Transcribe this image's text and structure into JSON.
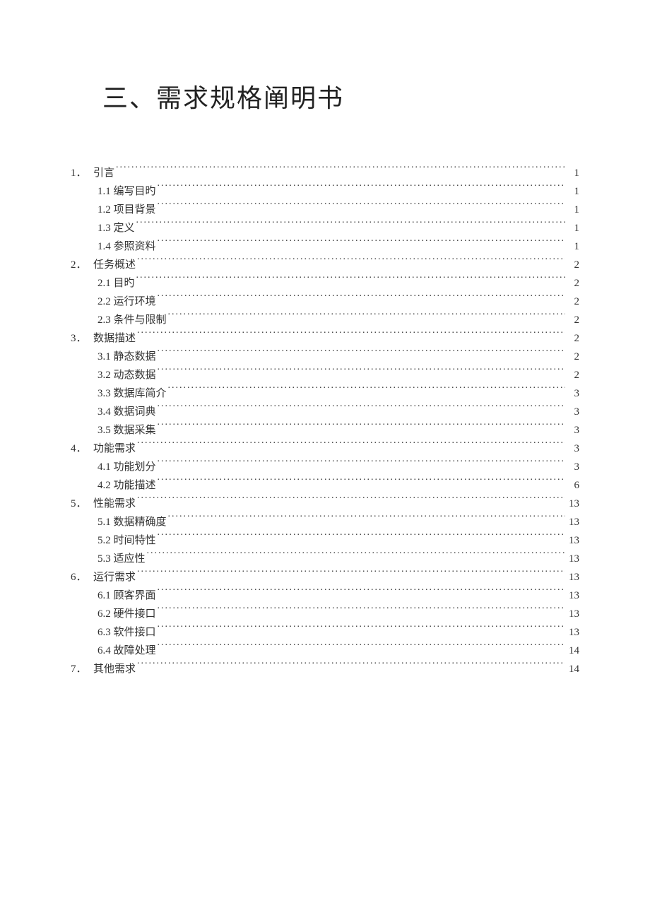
{
  "title": "三、需求规格阐明书",
  "toc": [
    {
      "level": 1,
      "num": "1．",
      "label": "引言",
      "page": "1"
    },
    {
      "level": 2,
      "num": "",
      "label": "1.1 编写目旳",
      "page": "1"
    },
    {
      "level": 2,
      "num": "",
      "label": "1.2 项目背景",
      "page": "1"
    },
    {
      "level": 2,
      "num": "",
      "label": "1.3 定义",
      "page": "1"
    },
    {
      "level": 2,
      "num": "",
      "label": "1.4 参照资料",
      "page": "1"
    },
    {
      "level": 1,
      "num": "2．",
      "label": "任务概述",
      "page": "2"
    },
    {
      "level": 2,
      "num": "",
      "label": "2.1 目旳",
      "page": "2"
    },
    {
      "level": 2,
      "num": "",
      "label": "2.2 运行环境",
      "page": "2"
    },
    {
      "level": 2,
      "num": "",
      "label": "2.3 条件与限制",
      "page": "2"
    },
    {
      "level": 1,
      "num": "3．",
      "label": "数据描述",
      "page": "2"
    },
    {
      "level": 2,
      "num": "",
      "label": "3.1 静态数据",
      "page": "2"
    },
    {
      "level": 2,
      "num": "",
      "label": "3.2 动态数据",
      "page": "2"
    },
    {
      "level": 2,
      "num": "",
      "label": "3.3 数据库简介",
      "page": "3"
    },
    {
      "level": 2,
      "num": "",
      "label": "3.4 数据词典",
      "page": "3"
    },
    {
      "level": 2,
      "num": "",
      "label": "3.5 数据采集",
      "page": "3"
    },
    {
      "level": 1,
      "num": "4．",
      "label": "功能需求",
      "page": "3"
    },
    {
      "level": 2,
      "num": "",
      "label": "4.1 功能划分",
      "page": "3"
    },
    {
      "level": 2,
      "num": "",
      "label": "4.2 功能描述",
      "page": "6"
    },
    {
      "level": 1,
      "num": "5．",
      "label": "性能需求",
      "page": "13"
    },
    {
      "level": 2,
      "num": "",
      "label": "5.1 数据精确度",
      "page": "13"
    },
    {
      "level": 2,
      "num": "",
      "label": "5.2 时间特性",
      "page": "13"
    },
    {
      "level": 2,
      "num": "",
      "label": "5.3 适应性",
      "page": "13"
    },
    {
      "level": 1,
      "num": "6．",
      "label": "运行需求",
      "page": "13"
    },
    {
      "level": 2,
      "num": "",
      "label": "6.1 顾客界面",
      "page": "13"
    },
    {
      "level": 2,
      "num": "",
      "label": "6.2 硬件接口",
      "page": "13"
    },
    {
      "level": 2,
      "num": "",
      "label": "6.3 软件接口",
      "page": "13"
    },
    {
      "level": 2,
      "num": "",
      "label": "6.4 故障处理",
      "page": "14"
    },
    {
      "level": 1,
      "num": "7．",
      "label": "其他需求",
      "page": "14"
    }
  ]
}
